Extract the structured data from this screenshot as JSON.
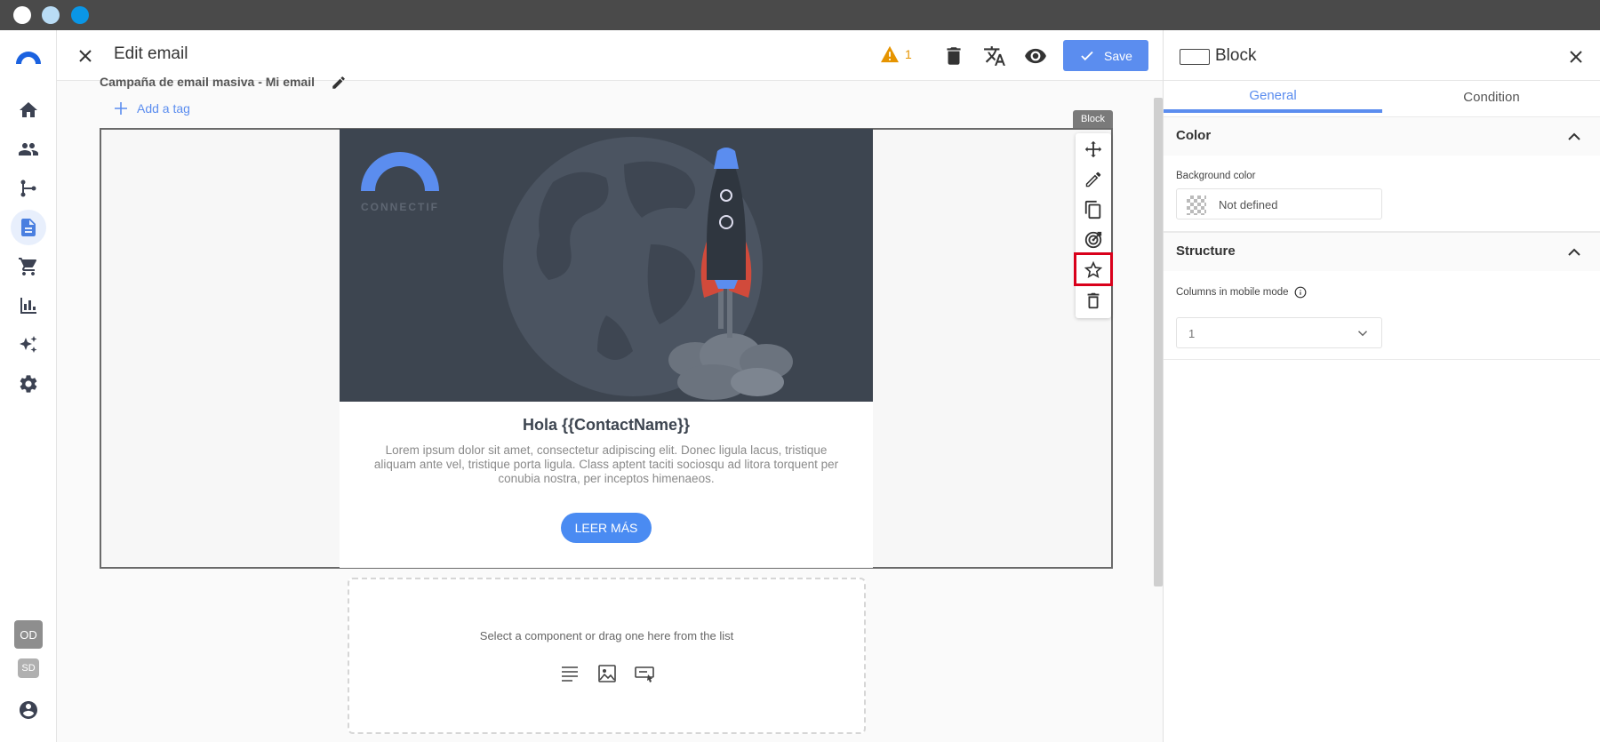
{
  "window": {
    "controls": [
      "close",
      "minimize",
      "maximize"
    ]
  },
  "sidebar": {
    "items": [
      {
        "icon": "home-icon",
        "active": false
      },
      {
        "icon": "contacts-icon",
        "active": false
      },
      {
        "icon": "workflow-icon",
        "active": false
      },
      {
        "icon": "content-icon",
        "active": true
      },
      {
        "icon": "cart-icon",
        "active": false
      },
      {
        "icon": "analytics-icon",
        "active": false
      },
      {
        "icon": "sparkles-icon",
        "active": false
      },
      {
        "icon": "settings-icon",
        "active": false
      }
    ],
    "badges": {
      "od": "OD",
      "sd": "SD"
    }
  },
  "header": {
    "title": "Edit email",
    "warning_count": "1",
    "save_label": "Save"
  },
  "editor": {
    "campaign_name": "Campaña de email masiva - Mi email",
    "add_tag_label": "Add a tag",
    "block_label": "Block",
    "email": {
      "logo_text": "CONNECTIF",
      "heading": "Hola {{ContactName}}",
      "body": "Lorem ipsum dolor sit amet, consectetur adipiscing elit. Donec ligula lacus, tristique aliquam ante vel, tristique porta ligula. Class aptent taciti sociosqu ad litora torquent per conubia nostra, per inceptos himenaeos.",
      "cta": "LEER MÁS"
    },
    "dropzone_text": "Select a component or drag one here from the list",
    "toolbar_actions": [
      "move-icon",
      "edit-icon",
      "duplicate-icon",
      "target-icon",
      "star-icon",
      "delete-icon"
    ]
  },
  "panel": {
    "title": "Block",
    "tabs": [
      "General",
      "Condition"
    ],
    "active_tab": "General",
    "color_section": {
      "title": "Color",
      "background_label": "Background color",
      "background_value": "Not defined"
    },
    "structure_section": {
      "title": "Structure",
      "columns_label": "Columns in mobile mode",
      "columns_value": "1"
    }
  },
  "colors": {
    "accent": "#5b8def",
    "hero_bg": "#3d4550",
    "warning": "#e69400",
    "highlight": "#d9001b"
  }
}
